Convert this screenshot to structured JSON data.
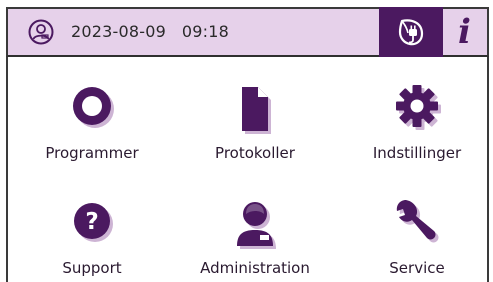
{
  "header": {
    "datetime": "2023-08-09   09:18",
    "user_icon": "user-badge-icon",
    "eco_icon": "eco-plug-leaf-icon",
    "info_label": "i"
  },
  "menu": {
    "tiles": [
      {
        "label": "Programmer",
        "icon": "ring-icon"
      },
      {
        "label": "Protokoller",
        "icon": "document-icon"
      },
      {
        "label": "Indstillinger",
        "icon": "gear-icon"
      },
      {
        "label": "Support",
        "icon": "question-icon"
      },
      {
        "label": "Administration",
        "icon": "administrator-icon"
      },
      {
        "label": "Service",
        "icon": "wrench-icon"
      }
    ]
  },
  "colors": {
    "accent": "#4b1960",
    "header_bg": "#e6d1ea",
    "icon_shadow": "#cdb4d4"
  }
}
